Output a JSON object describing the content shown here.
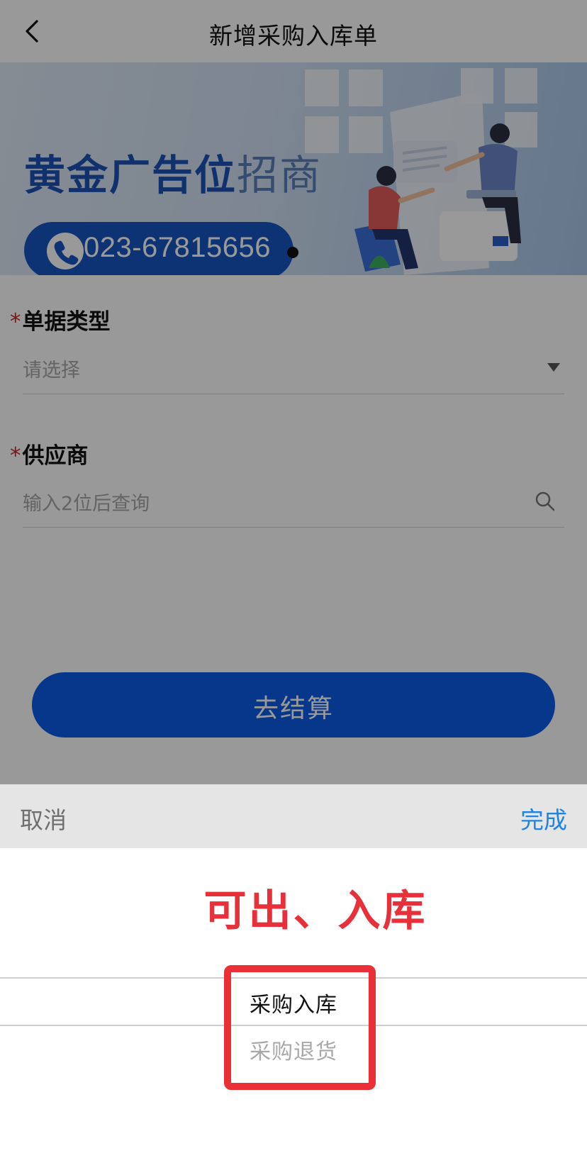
{
  "header": {
    "title": "新增采购入库单",
    "back_icon": "chevron-left-icon"
  },
  "banner": {
    "slogan_bold": "黄金广告位",
    "slogan_light": "招商",
    "phone": "023-67815656",
    "phone_icon": "phone-icon",
    "colors": {
      "slogan": "#1d53b8",
      "pill": "#1756c4"
    }
  },
  "form": {
    "document_type": {
      "required_mark": "*",
      "label": "单据类型",
      "placeholder": "请选择",
      "icon": "caret-down-icon"
    },
    "supplier": {
      "required_mark": "*",
      "label": "供应商",
      "placeholder": "输入2位后查询",
      "icon": "search-icon"
    },
    "submit_label": "去结算"
  },
  "picker": {
    "cancel_label": "取消",
    "done_label": "完成",
    "annotation": "可出、入库",
    "options": [
      {
        "label": "采购入库",
        "selected": true
      },
      {
        "label": "采购退货",
        "selected": false
      }
    ],
    "colors": {
      "done": "#1f84e0",
      "annotation": "#e8303a",
      "highlight_box": "#ea2f36"
    }
  }
}
